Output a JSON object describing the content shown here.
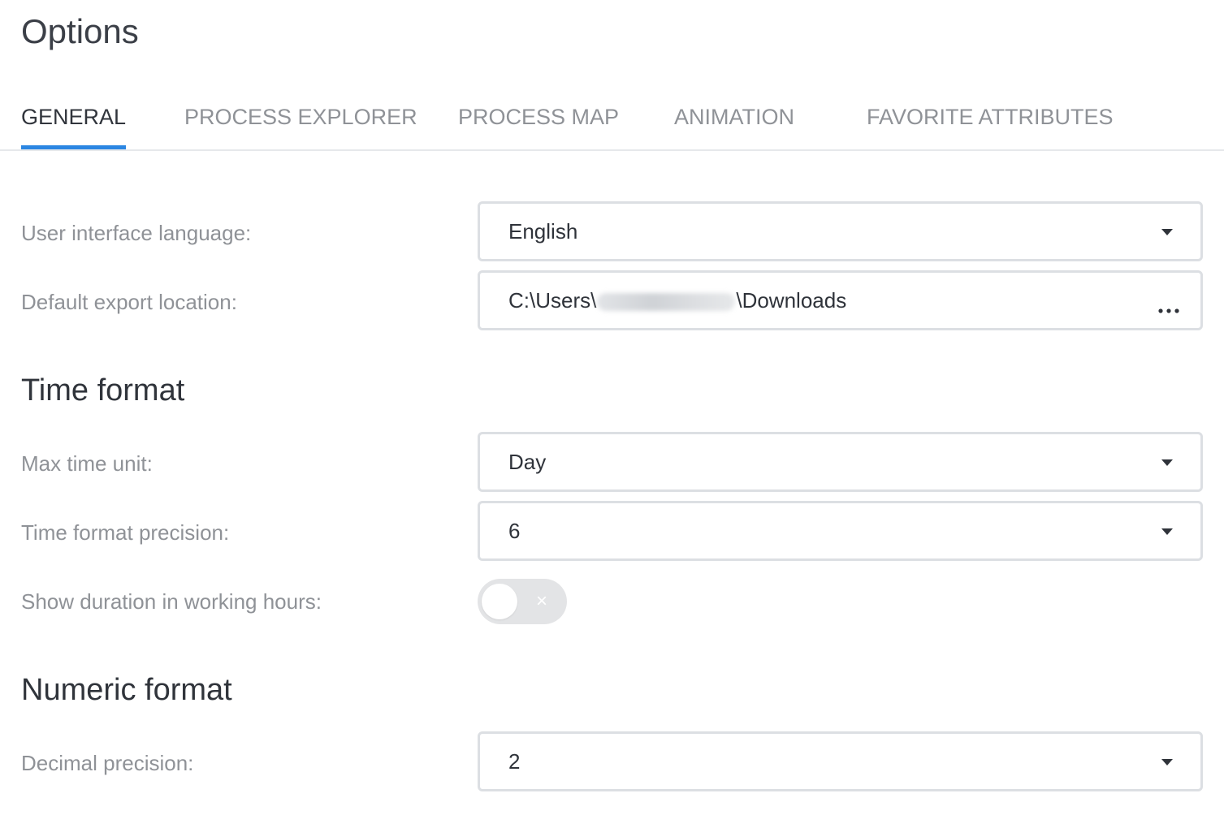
{
  "page": {
    "title": "Options"
  },
  "tabs": [
    {
      "label": "GENERAL",
      "active": true
    },
    {
      "label": "PROCESS EXPLORER",
      "active": false
    },
    {
      "label": "PROCESS MAP",
      "active": false
    },
    {
      "label": "ANIMATION",
      "active": false
    },
    {
      "label": "FAVORITE ATTRIBUTES",
      "active": false
    }
  ],
  "general": {
    "language": {
      "label": "User interface language:",
      "value": "English"
    },
    "export_location": {
      "label": "Default export location:",
      "value_prefix": "C:\\Users\\",
      "value_suffix": "\\Downloads",
      "browse_icon": "ellipsis-icon"
    }
  },
  "time_format": {
    "title": "Time format",
    "max_time_unit": {
      "label": "Max time unit:",
      "value": "Day"
    },
    "precision": {
      "label": "Time format precision:",
      "value": "6"
    },
    "working_hours": {
      "label": "Show duration in working hours:",
      "enabled": false,
      "off_glyph": "×"
    }
  },
  "numeric_format": {
    "title": "Numeric format",
    "decimal_precision": {
      "label": "Decimal precision:",
      "value": "2"
    }
  },
  "colors": {
    "accent": "#2b86e2",
    "border": "#dcdfe3",
    "label": "#8f9297",
    "text": "#2f333a"
  }
}
